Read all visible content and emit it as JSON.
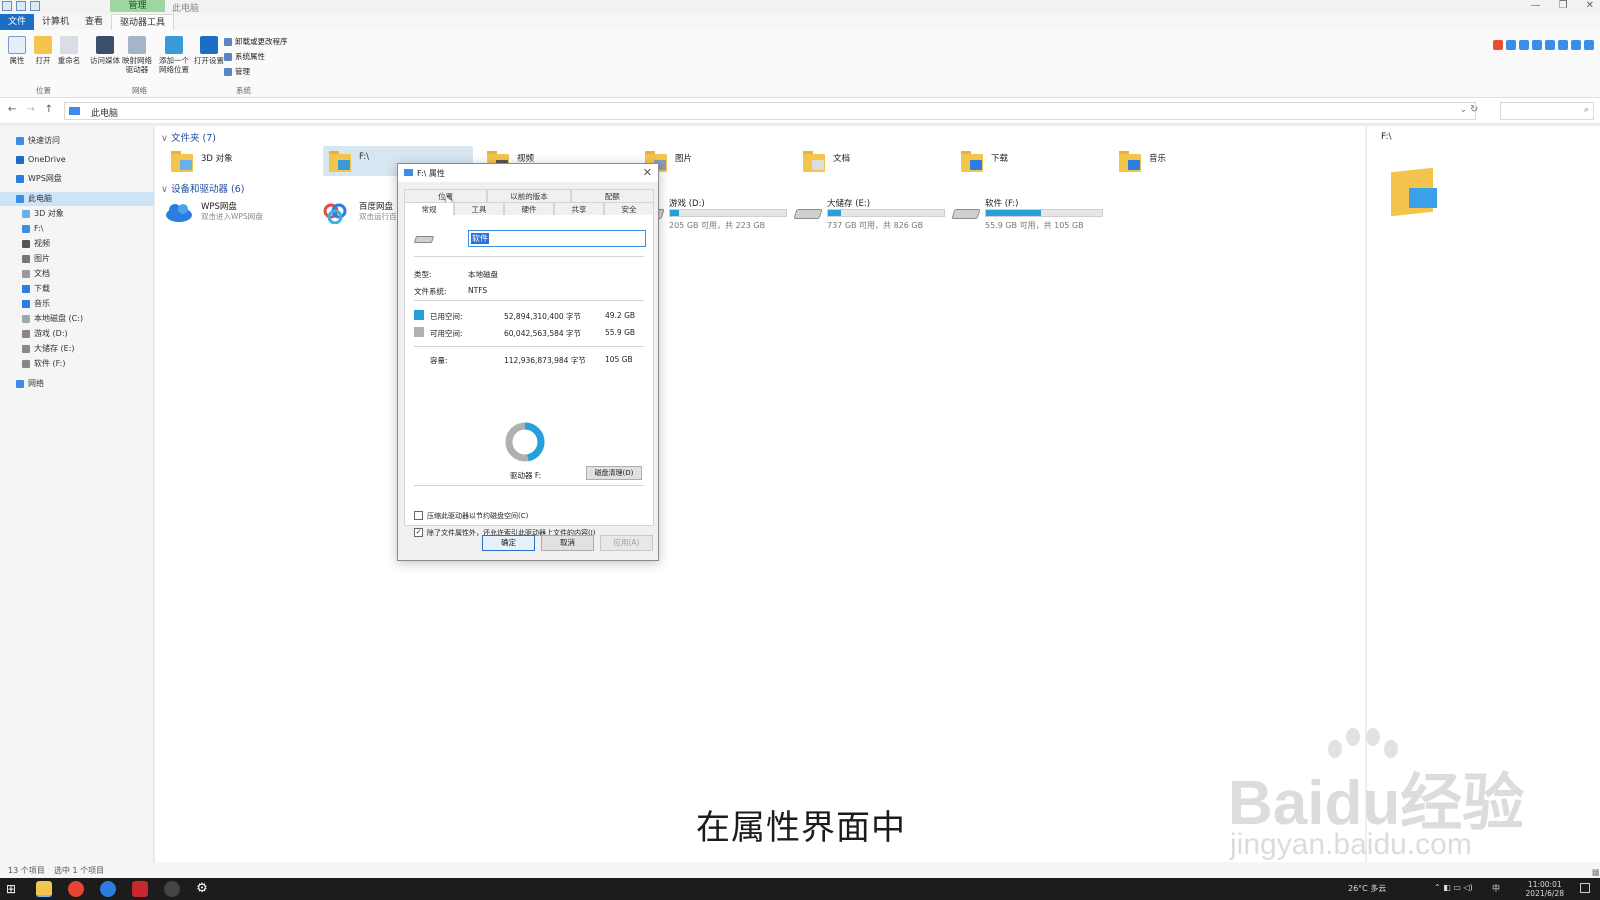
{
  "window": {
    "title": "此电脑",
    "context_tab": "管理"
  },
  "ribbon": {
    "tabs": [
      "文件",
      "计算机",
      "查看",
      "驱动器工具"
    ],
    "buttons": [
      "属性",
      "打开",
      "重命名",
      "访问媒体",
      "映射网络驱动器",
      "添加一个网络位置",
      "打开设置"
    ],
    "system_items": [
      "卸载或更改程序",
      "系统属性",
      "管理"
    ],
    "groups": [
      "位置",
      "网络",
      "系统"
    ]
  },
  "address": {
    "path": "此电脑",
    "search_placeholder": ""
  },
  "sidebar": {
    "items": [
      "快速访问",
      "OneDrive",
      "WPS网盘",
      "此电脑",
      "3D 对象",
      "F:\\",
      "视频",
      "图片",
      "文档",
      "下载",
      "音乐",
      "本地磁盘 (C:)",
      "游戏 (D:)",
      "大储存 (E:)",
      "软件 (F:)",
      "网络"
    ]
  },
  "main": {
    "folders_header": "文件夹 (7)",
    "folders": [
      "3D 对象",
      "F:\\",
      "视频",
      "图片",
      "文档",
      "下载",
      "音乐"
    ],
    "devices_header": "设备和驱动器 (6)",
    "cloud": [
      {
        "name": "WPS网盘",
        "sub": "双击进入WPS网盘"
      },
      {
        "name": "百度网盘",
        "sub": "双击运行百度网盘"
      }
    ],
    "drives": [
      {
        "name": "游戏 (D:)",
        "free": "205 GB 可用，共 223 GB",
        "used_fraction": 0.08
      },
      {
        "name": "大储存 (E:)",
        "free": "737 GB 可用，共 826 GB",
        "used_fraction": 0.11
      },
      {
        "name": "软件 (F:)",
        "free": "55.9 GB 可用，共 105 GB",
        "used_fraction": 0.47
      }
    ]
  },
  "preview": {
    "label": "F:\\"
  },
  "status": {
    "count": "13 个项目",
    "selected": "选中 1 个项目"
  },
  "taskbar": {
    "weather": "26°C 多云",
    "ime": "中",
    "time": "11:00:01",
    "date": "2021/6/28"
  },
  "dialog": {
    "title": "F:\\ 属性",
    "tabs_row1": [
      "位置",
      "以前的版本",
      "配额"
    ],
    "tabs_row2": [
      "常规",
      "工具",
      "硬件",
      "共享",
      "安全"
    ],
    "name_value": "软件",
    "type_label": "类型:",
    "type_value": "本地磁盘",
    "fs_label": "文件系统:",
    "fs_value": "NTFS",
    "used_label": "已用空间:",
    "used_bytes": "52,894,310,400 字节",
    "used_gb": "49.2 GB",
    "free_label": "可用空间:",
    "free_bytes": "60,042,563,584 字节",
    "free_gb": "55.9 GB",
    "cap_label": "容量:",
    "cap_bytes": "112,936,873,984 字节",
    "cap_gb": "105 GB",
    "used_fraction": 0.47,
    "drive_label": "驱动器 F:",
    "cleanup": "磁盘清理(D)",
    "compress": "压缩此驱动器以节约磁盘空间(C)",
    "index": "除了文件属性外，还允许索引此驱动器上文件的内容(I)",
    "index_checked": true,
    "ok": "确定",
    "cancel": "取消",
    "apply": "应用(A)"
  },
  "overlay": {
    "subtitle": "在属性界面中",
    "watermark": "Baidu经验",
    "watermark_url": "jingyan.baidu.com"
  },
  "colors": {
    "accent": "#26a0da",
    "file_tab": "#1a6fc4",
    "used": "#26a0da",
    "free": "#b0b0b0"
  }
}
